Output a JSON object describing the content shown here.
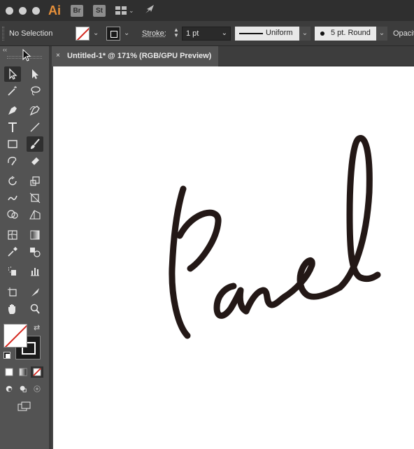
{
  "app": {
    "logo": "Ai",
    "bridge_label": "Br",
    "stock_label": "St"
  },
  "control_bar": {
    "selection_status": "No Selection",
    "stroke_label": "Stroke:",
    "stroke_weight": "1 pt",
    "variable_width_profile": "Uniform",
    "brush_definition": "5 pt. Round",
    "opacity_label": "Opacity"
  },
  "document": {
    "tab_title": "Untitled-1* @ 171% (RGB/GPU Preview)",
    "close_glyph": "×"
  },
  "tools": [
    "selection-tool",
    "direct-selection-tool",
    "magic-wand-tool",
    "lasso-tool",
    "pen-tool",
    "curvature-tool",
    "type-tool",
    "line-segment-tool",
    "rectangle-tool",
    "paintbrush-tool",
    "shaper-tool",
    "eraser-tool",
    "rotate-tool",
    "scale-tool",
    "warp-tool",
    "free-transform-tool",
    "shape-builder-tool",
    "perspective-grid-tool",
    "mesh-tool",
    "gradient-tool",
    "eyedropper-tool",
    "blend-tool",
    "symbol-sprayer-tool",
    "column-graph-tool",
    "artboard-tool",
    "slice-tool",
    "hand-tool",
    "zoom-tool"
  ],
  "colors": {
    "fill": "none",
    "stroke": "#1a1a1a",
    "accent": "#e8913a",
    "stroke_art": "#231816"
  }
}
